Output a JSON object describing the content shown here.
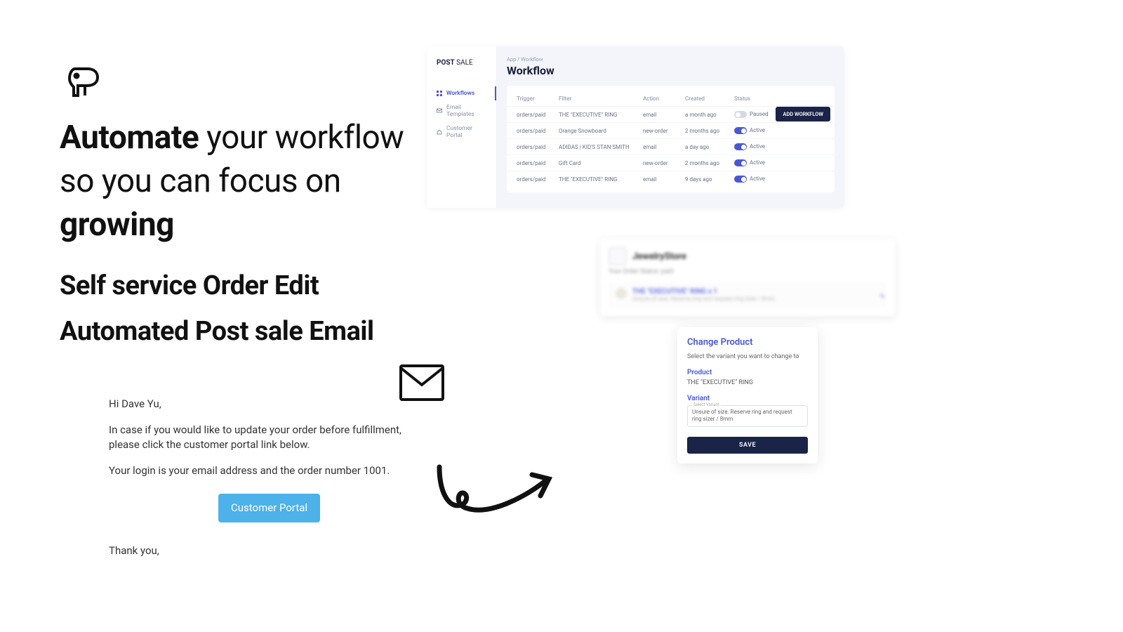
{
  "hero": {
    "word1": "Automate",
    "mid": " your workflow so you can focus on ",
    "word2": "growing"
  },
  "subhead1": "Self service Order Edit",
  "subhead2": "Automated Post sale Email",
  "email": {
    "greeting": "Hi Dave Yu,",
    "body1": "In case if you would like to update your order before fulfillment, please click the customer portal link below.",
    "body2": "Your login is your email address and the order number 1001.",
    "button": "Customer Portal",
    "thanks": "Thank you,"
  },
  "app": {
    "brand1": "POST",
    "brand2": " SALE",
    "nav": {
      "workflows": "Workflows",
      "templates": "Email Templates",
      "portal": "Customer Portal"
    },
    "crumb": "App / Workflow",
    "title": "Workflow",
    "addbtn": "ADD WORKFLOW",
    "cols": {
      "c1": "Trigger",
      "c2": "Filter",
      "c3": "Action",
      "c4": "Created",
      "c5": "Status"
    },
    "rows": [
      {
        "trigger": "orders/paid",
        "filter": "THE \"EXECUTIVE\" RING",
        "action": "email",
        "created": "a month ago",
        "statusOn": false,
        "statusText": "Paused"
      },
      {
        "trigger": "orders/paid",
        "filter": "Orange Snowboard",
        "action": "new-order",
        "created": "2 months ago",
        "statusOn": true,
        "statusText": "Active"
      },
      {
        "trigger": "orders/paid",
        "filter": "ADIDAS | KID'S STAN SMITH",
        "action": "email",
        "created": "a day ago",
        "statusOn": true,
        "statusText": "Active"
      },
      {
        "trigger": "orders/paid",
        "filter": "Gift Card",
        "action": "new-order",
        "created": "2 months ago",
        "statusOn": true,
        "statusText": "Active"
      },
      {
        "trigger": "orders/paid",
        "filter": "THE \"EXECUTIVE\" RING",
        "action": "email",
        "created": "9 days ago",
        "statusOn": true,
        "statusText": "Active"
      }
    ]
  },
  "order": {
    "store": "JewelryStore",
    "sub": "Your Order Status: paid",
    "item_title": "THE \"EXECUTIVE\" RING x 1",
    "item_sub": "Unsure of size. Reserve ring and request ring sizer / 8mm",
    "edit": "✎"
  },
  "modal": {
    "title": "Change Product",
    "desc": "Select the variant you want to change to",
    "product_lbl": "Product",
    "product_val": "THE \"EXECUTIVE\" RING",
    "variant_lbl": "Variant",
    "variant_mini": "Select Variant",
    "variant_val": "Unsure of size. Reserve ring and request ring sizer / 8mm",
    "save": "SAVE"
  }
}
